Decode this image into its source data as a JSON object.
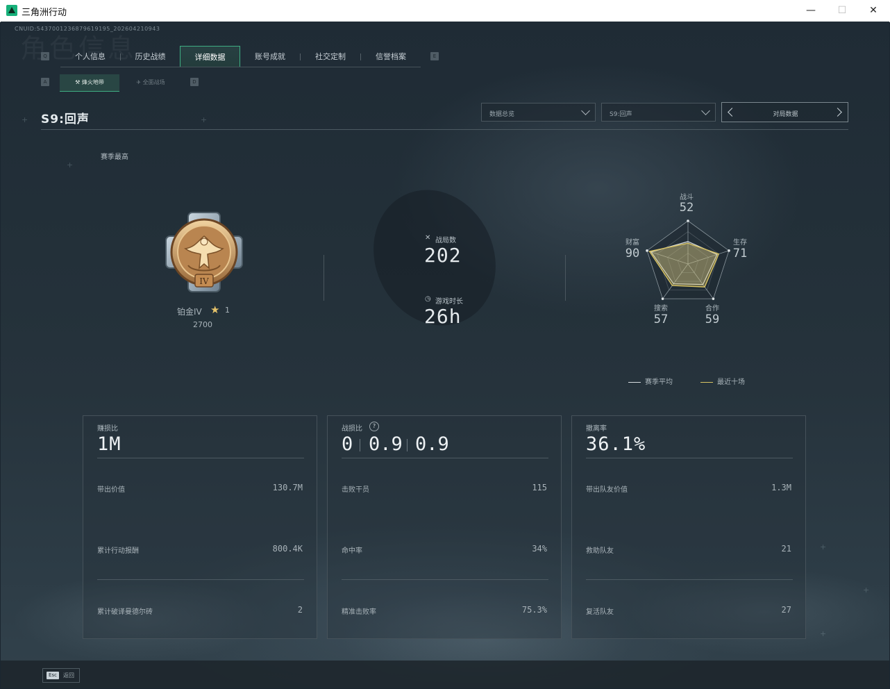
{
  "window": {
    "title": "三角洲行动",
    "min": "—",
    "max": "☐",
    "close": "✕"
  },
  "uid": "CNUID:5437001236879619195_202604210943",
  "watermark": "角色信息",
  "tabs": {
    "left_key": "Q",
    "right_key": "E",
    "items": [
      {
        "label": "个人信息"
      },
      {
        "label": "历史战绩"
      },
      {
        "label": "详细数据",
        "active": true
      },
      {
        "label": "账号成就"
      },
      {
        "label": "社交定制"
      },
      {
        "label": "信誉档案"
      }
    ]
  },
  "subtabs": {
    "left_key": "A",
    "right_key": "D",
    "items": [
      {
        "label": "烽火地带",
        "active": true
      },
      {
        "label": "全面战场"
      }
    ]
  },
  "season_title": "S9:回声",
  "filters": {
    "overview": "数据总览",
    "season": "S9:回声",
    "pager_label": "对局数据"
  },
  "season_best_label": "赛季最高",
  "rank": {
    "name": "铂金IV",
    "stars": "1",
    "score": "2700",
    "medal_numeral": "IV"
  },
  "stats": {
    "matches_label": "战局数",
    "matches": "202",
    "playtime_label": "游戏时长",
    "playtime": "26h"
  },
  "radar": {
    "axes": [
      {
        "label": "战斗",
        "value": 52
      },
      {
        "label": "生存",
        "value": 71
      },
      {
        "label": "合作",
        "value": 59
      },
      {
        "label": "搜索",
        "value": 57
      },
      {
        "label": "财富",
        "value": 90
      }
    ],
    "recent_values": [
      48,
      75,
      66,
      62,
      94
    ],
    "colors": {
      "season": "#d8dde0",
      "recent": "#d9c463"
    }
  },
  "legend": {
    "season_avg": "赛季平均",
    "recent_ten": "最近十场"
  },
  "cards": [
    {
      "title": "赚损比",
      "big": "1M",
      "rows": [
        {
          "label": "带出价值",
          "value": "130.7M"
        },
        {
          "label": "累计行动报酬",
          "value": "800.4K"
        },
        {
          "label": "累计破译曼德尔砖",
          "value": "2"
        }
      ]
    },
    {
      "title": "战损比",
      "help": "?",
      "ratios": [
        "0",
        "0.9",
        "0.9"
      ],
      "rows": [
        {
          "label": "击败干员",
          "value": "115"
        },
        {
          "label": "命中率",
          "value": "34%"
        },
        {
          "label": "精准击败率",
          "value": "75.3%"
        }
      ]
    },
    {
      "title": "撤离率",
      "big": "36.1%",
      "rows": [
        {
          "label": "带出队友价值",
          "value": "1.3M"
        },
        {
          "label": "救助队友",
          "value": "21"
        },
        {
          "label": "复活队友",
          "value": "27"
        }
      ]
    }
  ],
  "footer": {
    "esc_key": "Esc",
    "esc_label": "返回"
  }
}
